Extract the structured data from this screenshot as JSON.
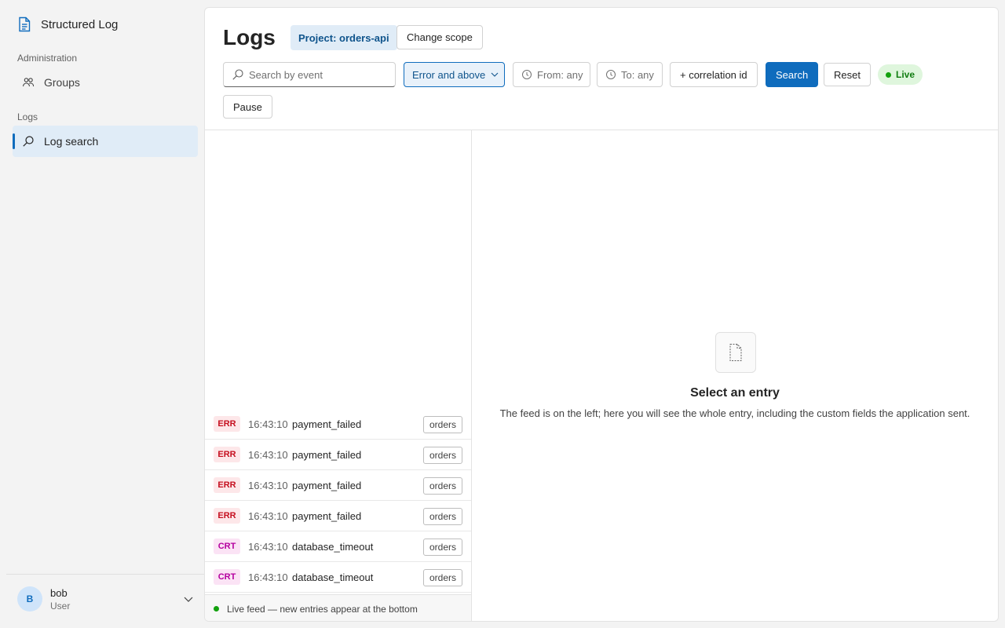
{
  "app": {
    "title": "Structured Log",
    "icon": "document-icon"
  },
  "sidebar": {
    "sections": [
      {
        "label": "Administration",
        "items": [
          {
            "label": "Groups",
            "icon": "people-icon"
          }
        ]
      },
      {
        "label": "Logs",
        "items": [
          {
            "label": "Log search",
            "icon": "search-icon",
            "active": true
          }
        ]
      }
    ]
  },
  "user": {
    "initial": "B",
    "name": "bob",
    "role": "User"
  },
  "header": {
    "title": "Logs",
    "scope_badge": "Project: orders-api",
    "change_scope": "Change scope"
  },
  "toolbar": {
    "search_placeholder": "Search by event",
    "level_filter": "Error and above",
    "from": "From: any",
    "to": "To: any",
    "correlation": "+ correlation id",
    "search": "Search",
    "reset": "Reset",
    "live": "Live",
    "pause": "Pause"
  },
  "feed": {
    "rows": [
      {
        "level": "ERR",
        "time": "16:43:10",
        "event": "payment_failed",
        "tag": "orders"
      },
      {
        "level": "ERR",
        "time": "16:43:10",
        "event": "payment_failed",
        "tag": "orders"
      },
      {
        "level": "ERR",
        "time": "16:43:10",
        "event": "payment_failed",
        "tag": "orders"
      },
      {
        "level": "ERR",
        "time": "16:43:10",
        "event": "payment_failed",
        "tag": "orders"
      },
      {
        "level": "CRT",
        "time": "16:43:10",
        "event": "database_timeout",
        "tag": "orders"
      },
      {
        "level": "CRT",
        "time": "16:43:10",
        "event": "database_timeout",
        "tag": "orders"
      }
    ],
    "footer": "Live feed — new entries appear at the bottom"
  },
  "detail": {
    "empty_title": "Select an entry",
    "empty_desc": "The feed is on the left; here you will see the whole entry, including the custom fields the application sent."
  },
  "colors": {
    "accent": "#0f6cbd",
    "err": "#c50f1f",
    "crt": "#b4009e",
    "live": "#107c10"
  }
}
